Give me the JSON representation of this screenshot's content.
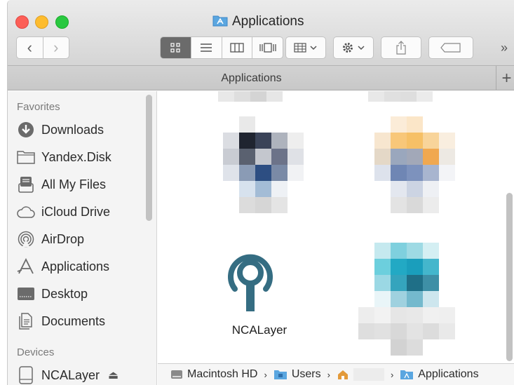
{
  "window": {
    "title": "Applications",
    "title_icon": "applications-folder-icon"
  },
  "toolbar": {
    "back": "‹",
    "forward": "›",
    "more": "»",
    "view_modes": [
      "icon-view-icon",
      "list-view-icon",
      "column-view-icon",
      "cover-flow-icon"
    ],
    "active_view": 0
  },
  "tabbar": {
    "tab_label": "Applications",
    "new_tab": "+"
  },
  "sidebar": {
    "favorites_header": "Favorites",
    "favorites": [
      {
        "label": "Downloads",
        "icon": "download-icon"
      },
      {
        "label": "Yandex.Disk",
        "icon": "folder-icon"
      },
      {
        "label": "All My Files",
        "icon": "all-files-icon"
      },
      {
        "label": "iCloud Drive",
        "icon": "cloud-icon"
      },
      {
        "label": "AirDrop",
        "icon": "airdrop-icon"
      },
      {
        "label": "Applications",
        "icon": "applications-icon"
      },
      {
        "label": "Desktop",
        "icon": "desktop-icon"
      },
      {
        "label": "Documents",
        "icon": "documents-icon"
      }
    ],
    "devices_header": "Devices",
    "devices": [
      {
        "label": "NCALayer",
        "icon": "disk-icon",
        "eject": "⏏"
      }
    ]
  },
  "content": {
    "items": [
      {
        "label": "NCALayer",
        "icon": "ncalayer-key-icon"
      }
    ]
  },
  "pathbar": {
    "segments": [
      {
        "label": "Macintosh HD",
        "icon": "hard-drive-icon"
      },
      {
        "label": "Users",
        "icon": "folder-icon"
      },
      {
        "label": "",
        "icon": "home-icon"
      },
      {
        "label": "Applications",
        "icon": "applications-folder-icon"
      }
    ],
    "separator": "›"
  },
  "colors": {
    "accent": "#3b6ea5",
    "ncalayer": "#356d82",
    "folder_blue": "#5aa6e0"
  }
}
